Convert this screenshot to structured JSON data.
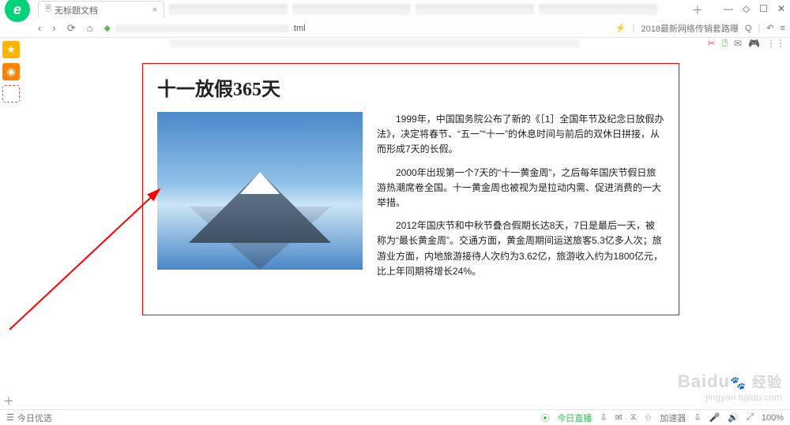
{
  "logo": {
    "letter": "e"
  },
  "tab": {
    "title": "无标题文档",
    "doc_icon": "🗎",
    "close": "×"
  },
  "new_tab": "＋",
  "window_controls": {
    "min": "—",
    "square": "◇",
    "max": "☐",
    "close": "✕"
  },
  "nav": {
    "back": "‹",
    "forward": "›",
    "refresh": "⟳",
    "home": "⌂",
    "shield": "◆",
    "address_suffix": "tml",
    "bolt": "⚡",
    "promo": "2018最新网络传销套路曝",
    "search": "Q",
    "undo": "↶",
    "menu": "≡"
  },
  "toolbar_right": {
    "cut": "✂",
    "check": "⍰",
    "msg": "✉",
    "game": "🎮",
    "grid": "⋮⋮"
  },
  "sidebar": {
    "lt": "◁",
    "star_icon": "★",
    "weibo_icon": "◉",
    "at_icon": "@"
  },
  "article": {
    "title": "十一放假365天",
    "p1": "1999年，中国国务院公布了新的《［1］全国年节及纪念日放假办法》，决定将春节、“五一”“十一”的休息时间与前后的双休日拼接，从而形成7天的长假。",
    "p2": "2000年出现第一个7天的“十一黄金周”，之后每年国庆节假日旅游热潮席卷全国。十一黄金周也被视为是拉动内需、促进消费的一大举措。",
    "p3": "2012年国庆节和中秋节叠合假期长达8天，7日是最后一天，被称为“最长黄金周”。交通方面，黄金周期间运送旅客5.3亿多人次；旅游业方面，内地旅游接待人次约为3.62亿，旅游收入约为1800亿元，比上年同期将增长24%。"
  },
  "bottom": {
    "plus": "＋",
    "today_icon": "☰",
    "today": "今日优选",
    "live_icon": "⦿",
    "live": "今日直播",
    "dl": "⇩",
    "mail": "✉",
    "history": "⧖",
    "star": "☆",
    "accel": "加速器",
    "down2": "⇩",
    "mic": "🎤",
    "sound": "🔊",
    "zoom_icon": "⤢",
    "zoom": "100%"
  },
  "watermark": {
    "brand": "Baidu",
    "paw": "🐾",
    "cn": "经验",
    "url": "jingyan.baidu.com"
  }
}
